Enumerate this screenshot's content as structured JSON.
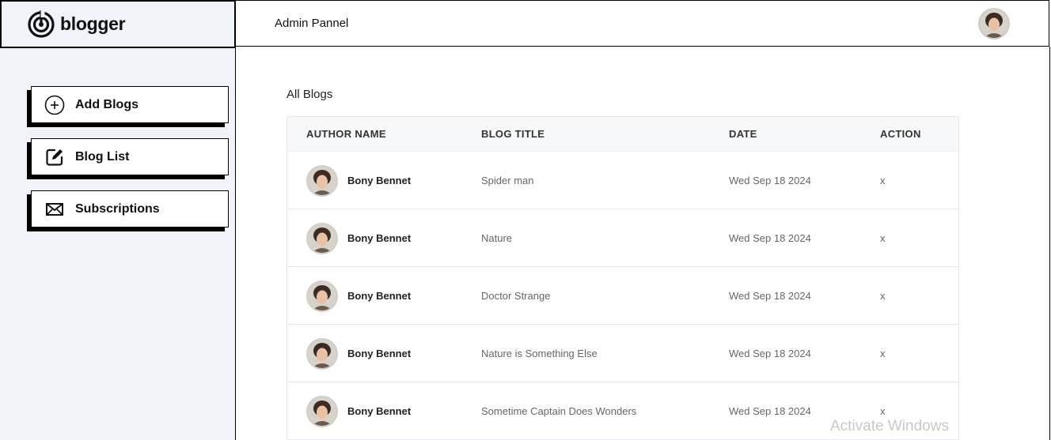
{
  "brand": {
    "name": "blogger",
    "icon": "blogger-logo-icon"
  },
  "header": {
    "title": "Admin Pannel",
    "avatar": "user-avatar"
  },
  "sidebar": {
    "items": [
      {
        "label": "Add Blogs",
        "icon": "plus-circle-icon"
      },
      {
        "label": "Blog List",
        "icon": "edit-icon"
      },
      {
        "label": "Subscriptions",
        "icon": "mail-icon"
      }
    ]
  },
  "main": {
    "section_title": "All Blogs",
    "table": {
      "columns": [
        "AUTHOR NAME",
        "BLOG TITLE",
        "DATE",
        "ACTION"
      ],
      "rows": [
        {
          "author": "Bony Bennet",
          "title": "Spider man",
          "date": "Wed Sep 18 2024",
          "action": "x"
        },
        {
          "author": "Bony Bennet",
          "title": "Nature",
          "date": "Wed Sep 18 2024",
          "action": "x"
        },
        {
          "author": "Bony Bennet",
          "title": "Doctor Strange",
          "date": "Wed Sep 18 2024",
          "action": "x"
        },
        {
          "author": "Bony Bennet",
          "title": "Nature is Something Else",
          "date": "Wed Sep 18 2024",
          "action": "x"
        },
        {
          "author": "Bony Bennet",
          "title": "Sometime Captain Does Wonders",
          "date": "Wed Sep 18 2024",
          "action": "x"
        }
      ]
    }
  },
  "os_overlay": {
    "watermark": "Activate Windows"
  },
  "colors": {
    "sidebar_bg": "#f0f3f9",
    "border": "#000000",
    "table_head_bg": "#f7f8fa"
  }
}
